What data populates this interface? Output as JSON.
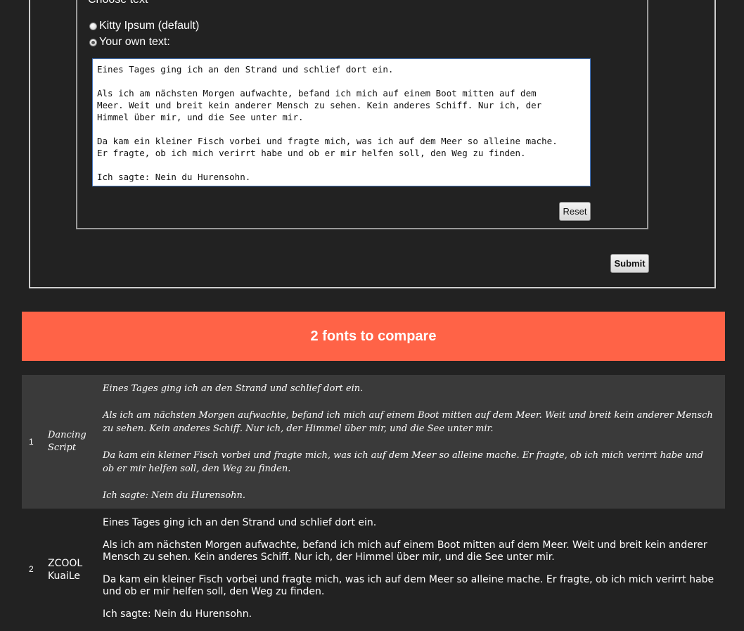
{
  "form": {
    "legend": "Choose text",
    "radio_options": [
      "Kitty Ipsum (default)",
      "Your own text:"
    ],
    "selected_option": "Your own text:",
    "textarea_value": "Eines Tages ging ich an den Strand und schlief dort ein.\n\nAls ich am nächsten Morgen aufwachte, befand ich mich auf einem Boot mitten auf dem\nMeer. Weit und breit kein anderer Mensch zu sehen. Kein anderes Schiff. Nur ich, der\nHimmel über mir, und die See unter mir.\n\nDa kam ein kleiner Fisch vorbei und fragte mich, was ich auf dem Meer so alleine mache.\nEr fragte, ob ich mich verirrt habe und ob er mir helfen soll, den Weg zu finden.\n\nIch sagte: Nein du Hurensohn.",
    "reset_label": "Reset",
    "submit_label": "Submit"
  },
  "banner": {
    "title": "2 fonts to compare",
    "color": "#ff6347"
  },
  "fonts": [
    {
      "index": "1",
      "name": "Dancing Script",
      "paragraphs": [
        "Eines Tages ging ich an den Strand und schlief dort ein.",
        "Als ich am nächsten Morgen aufwachte, befand ich mich auf einem Boot mitten auf dem Meer. Weit und breit kein anderer Mensch zu sehen. Kein anderes Schiff. Nur ich, der Himmel über mir, und die See unter mir.",
        "Da kam ein kleiner Fisch vorbei und fragte mich, was ich auf dem Meer so alleine mache. Er fragte, ob ich mich verirrt habe und ob er mir helfen soll, den Weg zu finden.",
        "Ich sagte: Nein du Hurensohn."
      ]
    },
    {
      "index": "2",
      "name": "ZCOOL KuaiLe",
      "paragraphs": [
        "Eines Tages ging ich an den Strand und schlief dort ein.",
        "Als ich am nächsten Morgen aufwachte, befand ich mich auf einem Boot mitten auf dem Meer. Weit und breit kein anderer Mensch zu sehen. Kein anderes Schiff. Nur ich, der Himmel über mir, und die See unter mir.",
        "Da kam ein kleiner Fisch vorbei und fragte mich, was ich auf dem Meer so alleine mache. Er fragte, ob ich mich verirrt habe und ob er mir helfen soll, den Weg zu finden.",
        "Ich sagte: Nein du Hurensohn."
      ]
    }
  ]
}
